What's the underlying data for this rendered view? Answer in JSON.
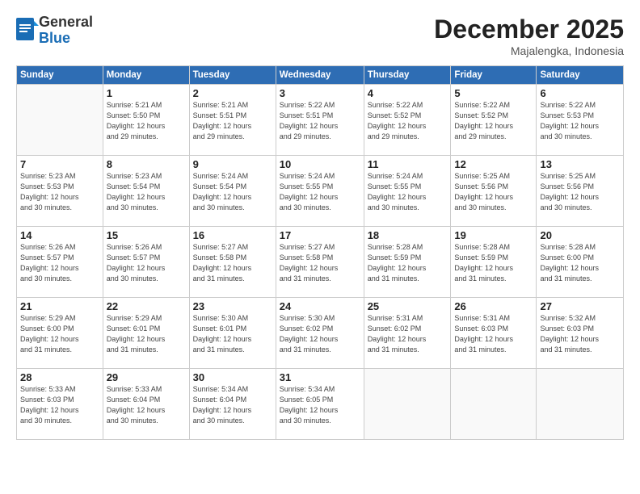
{
  "header": {
    "logo": {
      "general": "General",
      "blue": "Blue"
    },
    "title": "December 2025",
    "subtitle": "Majalengka, Indonesia"
  },
  "days_of_week": [
    "Sunday",
    "Monday",
    "Tuesday",
    "Wednesday",
    "Thursday",
    "Friday",
    "Saturday"
  ],
  "weeks": [
    [
      {
        "day": "",
        "info": ""
      },
      {
        "day": "1",
        "info": "Sunrise: 5:21 AM\nSunset: 5:50 PM\nDaylight: 12 hours\nand 29 minutes."
      },
      {
        "day": "2",
        "info": "Sunrise: 5:21 AM\nSunset: 5:51 PM\nDaylight: 12 hours\nand 29 minutes."
      },
      {
        "day": "3",
        "info": "Sunrise: 5:22 AM\nSunset: 5:51 PM\nDaylight: 12 hours\nand 29 minutes."
      },
      {
        "day": "4",
        "info": "Sunrise: 5:22 AM\nSunset: 5:52 PM\nDaylight: 12 hours\nand 29 minutes."
      },
      {
        "day": "5",
        "info": "Sunrise: 5:22 AM\nSunset: 5:52 PM\nDaylight: 12 hours\nand 29 minutes."
      },
      {
        "day": "6",
        "info": "Sunrise: 5:22 AM\nSunset: 5:53 PM\nDaylight: 12 hours\nand 30 minutes."
      }
    ],
    [
      {
        "day": "7",
        "info": "Sunrise: 5:23 AM\nSunset: 5:53 PM\nDaylight: 12 hours\nand 30 minutes."
      },
      {
        "day": "8",
        "info": "Sunrise: 5:23 AM\nSunset: 5:54 PM\nDaylight: 12 hours\nand 30 minutes."
      },
      {
        "day": "9",
        "info": "Sunrise: 5:24 AM\nSunset: 5:54 PM\nDaylight: 12 hours\nand 30 minutes."
      },
      {
        "day": "10",
        "info": "Sunrise: 5:24 AM\nSunset: 5:55 PM\nDaylight: 12 hours\nand 30 minutes."
      },
      {
        "day": "11",
        "info": "Sunrise: 5:24 AM\nSunset: 5:55 PM\nDaylight: 12 hours\nand 30 minutes."
      },
      {
        "day": "12",
        "info": "Sunrise: 5:25 AM\nSunset: 5:56 PM\nDaylight: 12 hours\nand 30 minutes."
      },
      {
        "day": "13",
        "info": "Sunrise: 5:25 AM\nSunset: 5:56 PM\nDaylight: 12 hours\nand 30 minutes."
      }
    ],
    [
      {
        "day": "14",
        "info": "Sunrise: 5:26 AM\nSunset: 5:57 PM\nDaylight: 12 hours\nand 30 minutes."
      },
      {
        "day": "15",
        "info": "Sunrise: 5:26 AM\nSunset: 5:57 PM\nDaylight: 12 hours\nand 30 minutes."
      },
      {
        "day": "16",
        "info": "Sunrise: 5:27 AM\nSunset: 5:58 PM\nDaylight: 12 hours\nand 31 minutes."
      },
      {
        "day": "17",
        "info": "Sunrise: 5:27 AM\nSunset: 5:58 PM\nDaylight: 12 hours\nand 31 minutes."
      },
      {
        "day": "18",
        "info": "Sunrise: 5:28 AM\nSunset: 5:59 PM\nDaylight: 12 hours\nand 31 minutes."
      },
      {
        "day": "19",
        "info": "Sunrise: 5:28 AM\nSunset: 5:59 PM\nDaylight: 12 hours\nand 31 minutes."
      },
      {
        "day": "20",
        "info": "Sunrise: 5:28 AM\nSunset: 6:00 PM\nDaylight: 12 hours\nand 31 minutes."
      }
    ],
    [
      {
        "day": "21",
        "info": "Sunrise: 5:29 AM\nSunset: 6:00 PM\nDaylight: 12 hours\nand 31 minutes."
      },
      {
        "day": "22",
        "info": "Sunrise: 5:29 AM\nSunset: 6:01 PM\nDaylight: 12 hours\nand 31 minutes."
      },
      {
        "day": "23",
        "info": "Sunrise: 5:30 AM\nSunset: 6:01 PM\nDaylight: 12 hours\nand 31 minutes."
      },
      {
        "day": "24",
        "info": "Sunrise: 5:30 AM\nSunset: 6:02 PM\nDaylight: 12 hours\nand 31 minutes."
      },
      {
        "day": "25",
        "info": "Sunrise: 5:31 AM\nSunset: 6:02 PM\nDaylight: 12 hours\nand 31 minutes."
      },
      {
        "day": "26",
        "info": "Sunrise: 5:31 AM\nSunset: 6:03 PM\nDaylight: 12 hours\nand 31 minutes."
      },
      {
        "day": "27",
        "info": "Sunrise: 5:32 AM\nSunset: 6:03 PM\nDaylight: 12 hours\nand 31 minutes."
      }
    ],
    [
      {
        "day": "28",
        "info": "Sunrise: 5:33 AM\nSunset: 6:03 PM\nDaylight: 12 hours\nand 30 minutes."
      },
      {
        "day": "29",
        "info": "Sunrise: 5:33 AM\nSunset: 6:04 PM\nDaylight: 12 hours\nand 30 minutes."
      },
      {
        "day": "30",
        "info": "Sunrise: 5:34 AM\nSunset: 6:04 PM\nDaylight: 12 hours\nand 30 minutes."
      },
      {
        "day": "31",
        "info": "Sunrise: 5:34 AM\nSunset: 6:05 PM\nDaylight: 12 hours\nand 30 minutes."
      },
      {
        "day": "",
        "info": ""
      },
      {
        "day": "",
        "info": ""
      },
      {
        "day": "",
        "info": ""
      }
    ]
  ]
}
